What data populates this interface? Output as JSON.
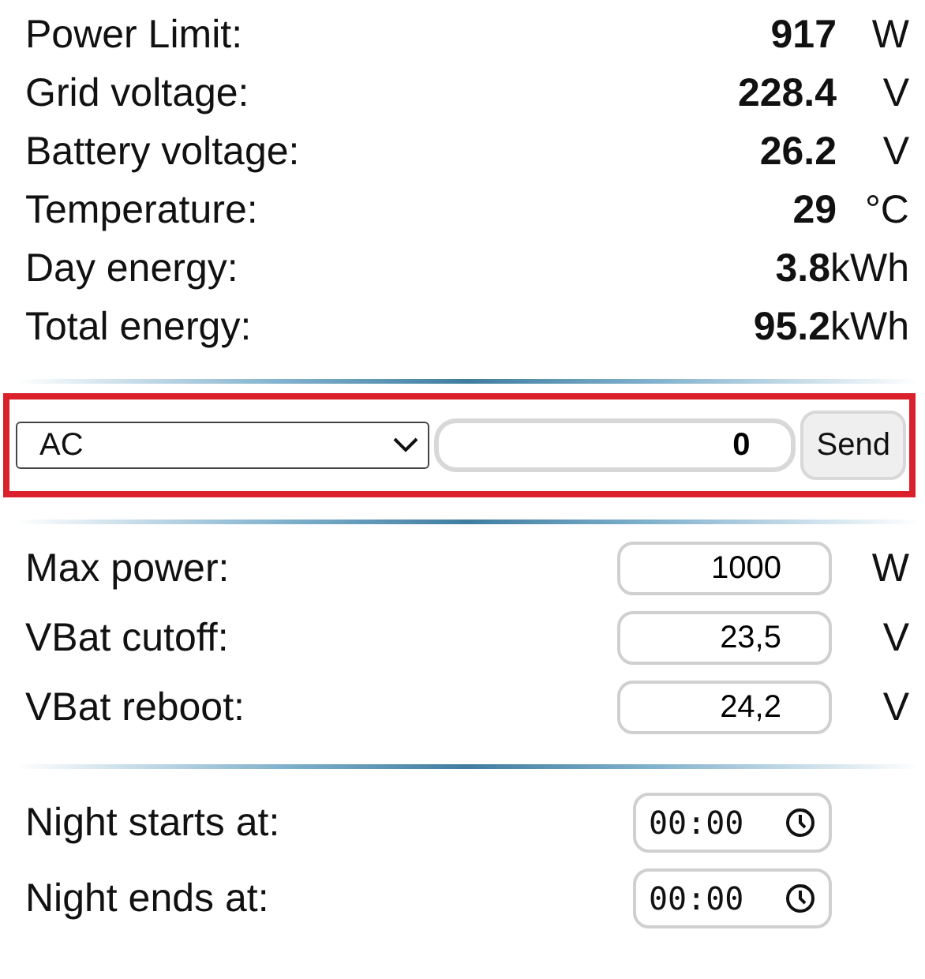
{
  "stats": [
    {
      "label": "Power Limit:",
      "value": "917",
      "unit": "W"
    },
    {
      "label": "Grid voltage:",
      "value": "228.4",
      "unit": "V"
    },
    {
      "label": "Battery voltage:",
      "value": "26.2",
      "unit": "V"
    },
    {
      "label": "Temperature:",
      "value": "29",
      "unit": "°C"
    },
    {
      "label": "Day energy:",
      "value": "3.8",
      "unit": "kWh"
    },
    {
      "label": "Total energy:",
      "value": "95.2",
      "unit": "kWh"
    }
  ],
  "command": {
    "highlighted": true,
    "mode": "AC",
    "value": "0",
    "button": "Send"
  },
  "settings": [
    {
      "label": "Max power:",
      "value": "1000",
      "unit": "W"
    },
    {
      "label": "VBat cutoff:",
      "value": "23,5",
      "unit": "V"
    },
    {
      "label": "VBat reboot:",
      "value": "24,2",
      "unit": "V"
    }
  ],
  "schedule": [
    {
      "label": "Night starts at:",
      "value": "00:00"
    },
    {
      "label": "Night ends at:",
      "value": "00:00"
    }
  ]
}
